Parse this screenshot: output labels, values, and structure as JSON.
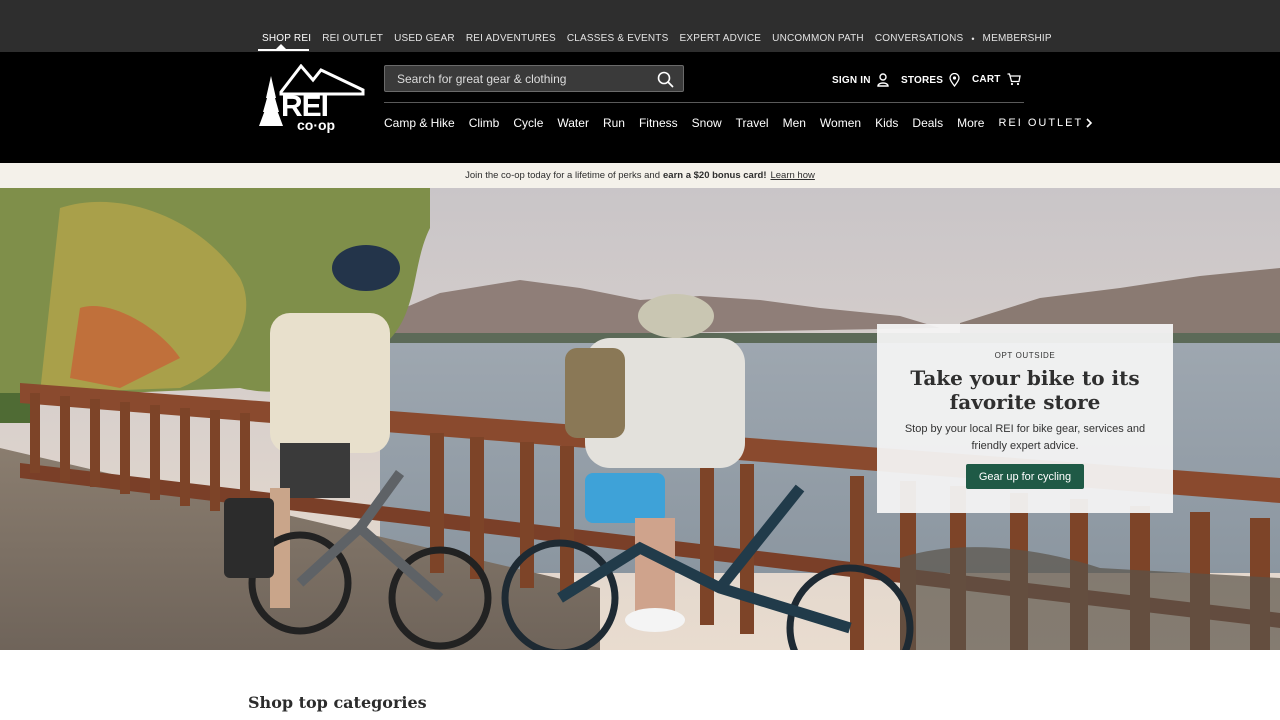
{
  "utility_nav": {
    "items": [
      {
        "label": "SHOP REI",
        "active": true
      },
      {
        "label": "REI OUTLET"
      },
      {
        "label": "USED GEAR"
      },
      {
        "label": "REI ADVENTURES"
      },
      {
        "label": "CLASSES & EVENTS"
      },
      {
        "label": "EXPERT ADVICE"
      },
      {
        "label": "UNCOMMON PATH"
      },
      {
        "label": "CONVERSATIONS"
      },
      {
        "label": "MEMBERSHIP"
      }
    ],
    "separator": "•"
  },
  "header": {
    "logo_text": "REI co-op",
    "search_placeholder": "Search for great gear & clothing",
    "sign_in": "SIGN IN",
    "stores": "STORES",
    "cart": "CART"
  },
  "main_nav": {
    "items": [
      "Camp & Hike",
      "Climb",
      "Cycle",
      "Water",
      "Run",
      "Fitness",
      "Snow",
      "Travel",
      "Men",
      "Women",
      "Kids",
      "Deals",
      "More"
    ],
    "outlet": "REI OUTLET"
  },
  "promo": {
    "text": "Join the co-op today for a lifetime of perks and",
    "bold": "earn a $20 bonus card!",
    "link": "Learn how"
  },
  "hero": {
    "eyebrow": "OPT OUTSIDE",
    "title": "Take your bike to its favorite store",
    "body": "Stop by your local REI for bike gear, services and friendly expert advice.",
    "cta": "Gear up for cycling"
  },
  "section": {
    "title": "Shop top categories"
  },
  "colors": {
    "topbar": "#2e2e2e",
    "header": "#000000",
    "promo_bg": "#f4f1ea",
    "cta_green": "#1f5a46"
  }
}
